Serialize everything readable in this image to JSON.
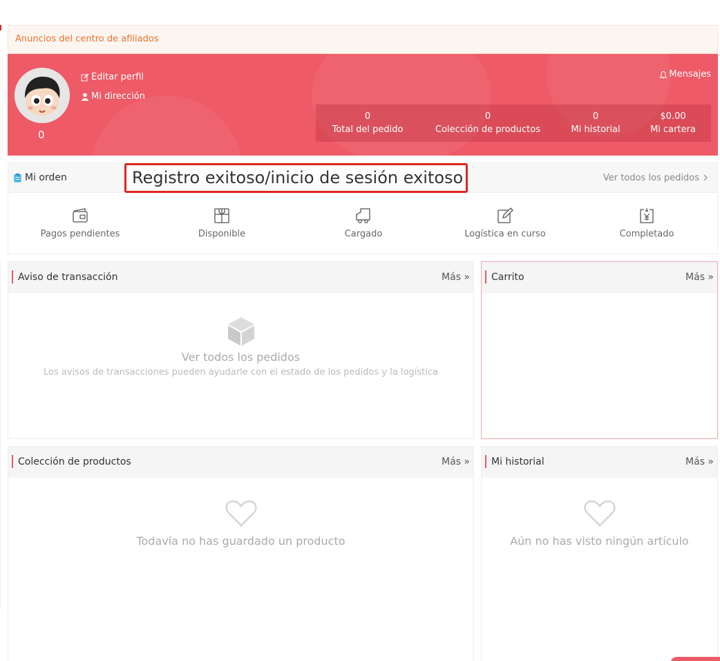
{
  "announcement": "Anuncios del centro de afiliados",
  "profile": {
    "avatar_count": "0",
    "edit_profile": "Editar perfil",
    "my_address": "Mi dirección",
    "messages": "Mensajes",
    "stats": [
      {
        "value": "0",
        "label": "Total del pedido"
      },
      {
        "value": "0",
        "label": "Colección de productos"
      },
      {
        "value": "0",
        "label": "Mi historial"
      },
      {
        "value": "$0.00",
        "label": "Mi cartera"
      }
    ]
  },
  "orders": {
    "title": "Mi orden",
    "view_all": "Ver todos los pedidos",
    "statuses": [
      {
        "label": "Pagos pendientes",
        "icon": "wallet-icon"
      },
      {
        "label": "Disponible",
        "icon": "package-icon"
      },
      {
        "label": "Cargado",
        "icon": "truck-icon"
      },
      {
        "label": "Logística en curso",
        "icon": "edit-icon"
      },
      {
        "label": "Completado",
        "icon": "yen-receipt-icon"
      }
    ]
  },
  "toast": "Registro exitoso/inicio de sesión exitoso",
  "panels": {
    "more_label": "Más »",
    "transactions": {
      "title": "Aviso de transacción",
      "empty_title": "Ver todos los pedidos",
      "empty_desc": "Los avisos de transacciones pueden ayudarle con el estado de los pedidos y la logística"
    },
    "cart": {
      "title": "Carrito"
    },
    "collection": {
      "title": "Colección de productos",
      "empty_text": "Todavía no has guardado un producto"
    },
    "history": {
      "title": "Mi historial",
      "empty_text": "Aún no has visto ningún artículo"
    }
  },
  "colors": {
    "brand": "#ee5a66",
    "accent_bar": "#e25b66",
    "toast_border": "#e0251f",
    "announce_text": "#e8732e"
  }
}
